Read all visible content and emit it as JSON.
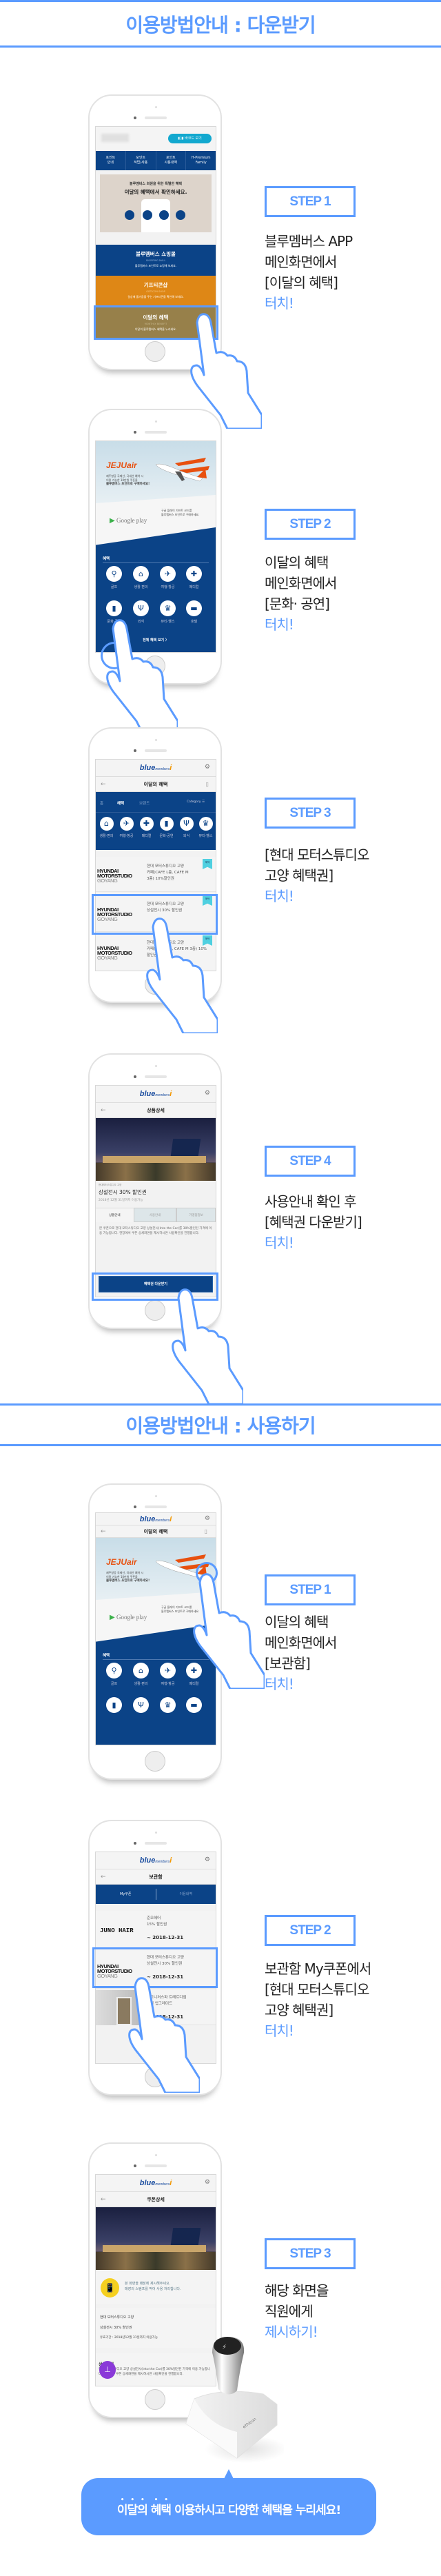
{
  "colors": {
    "accent": "#5b9bff",
    "navy": "#0b4387",
    "orange": "#de8716",
    "gold": "#97804a"
  },
  "sections": [
    {
      "title": "이용방법안내 : 다운받기"
    },
    {
      "title": "이용방법안내 : 사용하기"
    }
  ],
  "steps": [
    {
      "label": "STEP 1",
      "lines": [
        "블루멤버스 APP",
        "메인화면에서",
        "[이달의 혜택]"
      ],
      "action": "터치!"
    },
    {
      "label": "STEP 2",
      "lines": [
        "이달의 혜택",
        "메인화면에서",
        "[문화· 공연]"
      ],
      "action": "터치!"
    },
    {
      "label": "STEP 3",
      "lines": [
        "[현대 모터스튜디오",
        "고양 혜택권]"
      ],
      "action": "터치!"
    },
    {
      "label": "STEP 4",
      "lines": [
        "사용안내 확인 후",
        "[혜택권 다운받기]"
      ],
      "action": "터치!"
    },
    {
      "label": "STEP 1",
      "lines": [
        "이달의 혜택",
        "메인화면에서",
        "[보관함]"
      ],
      "action": "터치!"
    },
    {
      "label": "STEP 2",
      "lines": [
        "보관함  My쿠폰에서",
        "[현대 모터스튜디오",
        "고양 혜택권]"
      ],
      "action": "터치!"
    },
    {
      "label": "STEP 3",
      "lines": [
        "해당 화면을",
        "직원에게"
      ],
      "action": "제시하기!"
    }
  ],
  "app": {
    "logo": {
      "main": "blue",
      "sub": "members",
      "i": "i"
    },
    "home": {
      "barcode_button": "바코드 보기",
      "nav": [
        {
          "l1": "포인트",
          "l2": "안내"
        },
        {
          "l1": "포인트",
          "l2": "적립/사용"
        },
        {
          "l1": "포인트",
          "l2": "사용내역"
        },
        {
          "l1": "H-Premium",
          "l2": "Family"
        }
      ],
      "promo_small": "블루멤버스 회원을 위한 특별한 혜택",
      "promo_big": "이달의 혜택에서 확인하세요.",
      "tiles": [
        {
          "title": "블루멤버스 쇼핑몰",
          "sub": "SHOPPING MALL",
          "desc": "블루멤버스 포인트로 쇼핑해 보세요."
        },
        {
          "title": "기프티콘샵",
          "sub": "GIFTICON SHOP",
          "desc": "일상에 즐거움을 주는 기프티콘을 확인해 보세요."
        },
        {
          "title": "이달의 혜택",
          "sub": "MONTHLY BENEFIT",
          "desc": "이달의 블루멤버스 혜택을 누리세요."
        }
      ]
    },
    "benefit_main": {
      "title": "이달의 혜택",
      "jeju_logo": "JEJUair",
      "jeju_text": [
        "제주항공 국제선, 국내선 예약 시",
        "이용 가능한 10만원 쿠폰을",
        "블루멤버스 포인트로 구매하세요!"
      ],
      "google_logo": "Google play",
      "google_text": [
        "구글 플레이 기프트 코드를",
        "블루멤버스 포인트로 구매하세요."
      ],
      "section_label": "혜택",
      "categories": [
        {
          "label": "골프",
          "icon": "golf-icon",
          "glyph": "⚲"
        },
        {
          "label": "생활·편의",
          "icon": "home-icon",
          "glyph": "⌂"
        },
        {
          "label": "여행·항공",
          "icon": "plane-icon",
          "glyph": "✈"
        },
        {
          "label": "메디컬",
          "icon": "medical-icon",
          "glyph": "✚"
        },
        {
          "label": "문화·공연",
          "icon": "book-icon",
          "glyph": "▮"
        },
        {
          "label": "외식",
          "icon": "dining-icon",
          "glyph": "Ψ"
        },
        {
          "label": "뷰티·헬스",
          "icon": "crown-icon",
          "glyph": "♛"
        },
        {
          "label": "호텔",
          "icon": "bed-icon",
          "glyph": "▬"
        }
      ],
      "all_link": "전체 혜택 보기 〉"
    },
    "benefit_list": {
      "title": "이달의 혜택",
      "tabs": [
        "홈",
        "혜택",
        "브랜드"
      ],
      "category_label": "Category",
      "strip": [
        "생활·편의",
        "여행·항공",
        "메디컬",
        "문화·공연",
        "외식",
        "뷰티·헬스"
      ],
      "badge": "혜택",
      "brand_logo": {
        "l1": "HYUNDAI",
        "l2": "MOTORSTUDIO",
        "l3": "GOYANG"
      },
      "items": [
        {
          "name": "현대 모터스튜디오 고양",
          "desc1": "카페(CAFE L층, CAFE M",
          "desc2": "3층) 10%할인권"
        },
        {
          "name": "현대 모터스튜디오 고양",
          "desc1": "상설전시 30% 할인권",
          "desc2": ""
        },
        {
          "name": "현대 모터스튜디오 고양",
          "desc1": "카페(CAFE L층, CAFE M 3층) 10%",
          "desc2": "할인권"
        }
      ]
    },
    "product_detail": {
      "title": "상품상세",
      "brand": "현대모터스튜디오 고양",
      "name": "상설전시 30% 할인권",
      "period": "2018년 12월 31일까지 이용가능",
      "tabs": [
        "상품안내",
        "사용안내",
        "가맹점정보"
      ],
      "body": "본 쿠폰으로 현대 모터스튜디오 고양 상설전시(Into the Car)를 30%할인된 가격에 이용 가능합니다. 현장에서 쿠폰 상세화면을 제시하시면 사용확인을 진행합니다.",
      "download_button": "혜택권 다운받기"
    },
    "storage": {
      "title": "보관함",
      "tabs": [
        "My쿠폰",
        "이용내역"
      ],
      "juno_logo": "JUNO HAIR",
      "items": [
        {
          "name": "준오헤어",
          "desc": "15% 할인권",
          "expiry": "~ 2018-12-31"
        },
        {
          "name": "현대 모터스튜디오 고양",
          "desc": "상설전시 30% 할인권",
          "expiry": "~ 2018-12-31"
        },
        {
          "name": "시그니처스파 트레르디엠",
          "desc": "객실 업그레이드",
          "expiry": "~ 2018-12-31"
        }
      ]
    },
    "coupon_detail": {
      "title": "쿠폰상세",
      "notice": [
        "본 화면을 매장에 제시해주세요.",
        "매장의 스탬프를 찍어 사용 처리합니다."
      ],
      "brand": "현대 모터스튜디오 고양",
      "name": "상설전시 30% 할인권",
      "period": "유효기간 : 2018년12월 31일까지 이용가능",
      "section": "상품안내",
      "body": "현대 모터스튜디오 고양 상설전시(Into the Car)를 30%할인된 가격에 이용 가능합니다. 현장에서 쿠폰 상세화면을 제시하시면 사용확인을 진행합니다."
    }
  },
  "stamp": {
    "brand": "ethicon"
  },
  "banner": {
    "emphasis": "이달의 혜택",
    "rest": " 이용하시고 다양한 혜택을 누리세요!"
  }
}
